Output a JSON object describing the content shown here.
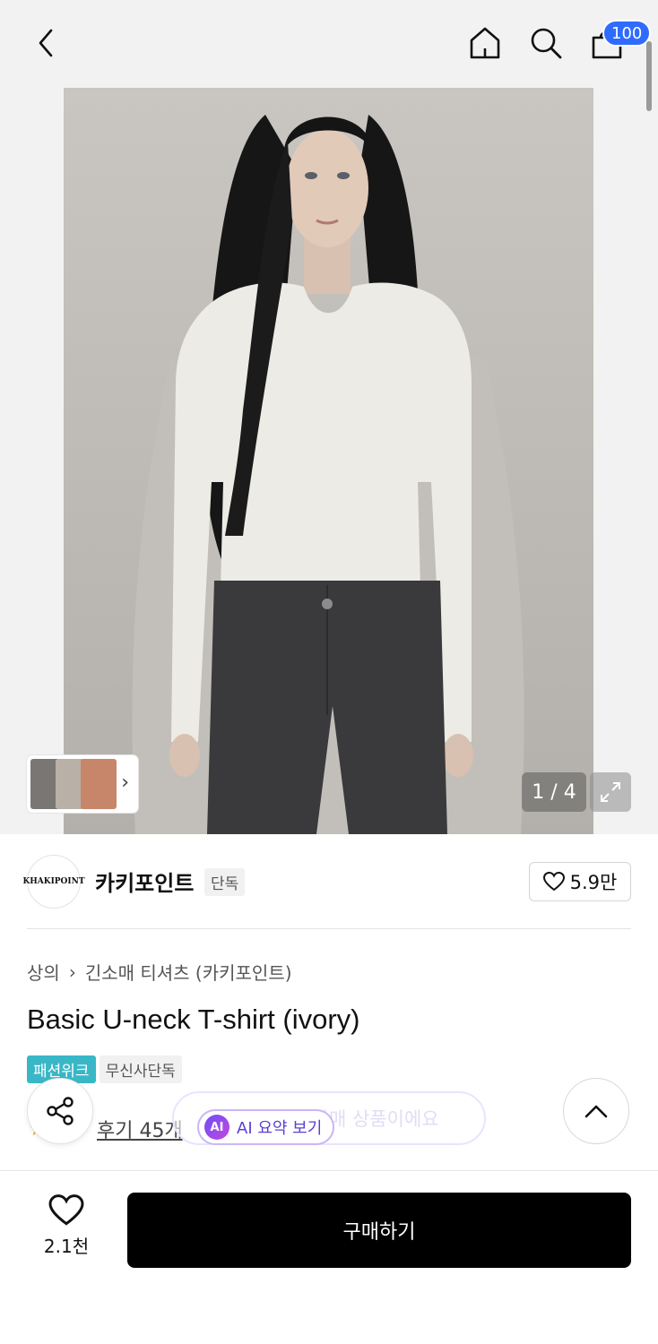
{
  "topbar": {
    "cart_count": "100"
  },
  "gallery": {
    "counter": "1 / 4"
  },
  "brand": {
    "name": "카키포인트",
    "tag": "단독",
    "logo_text": "KHAKIPOINT",
    "likes": "5.9만"
  },
  "breadcrumb": {
    "category": "상의",
    "subcategory": "긴소매 티셔츠 (카키포인트)"
  },
  "product": {
    "title": "Basic U-neck T-shirt (ivory)",
    "badges": [
      "패션위크",
      "무신사단독"
    ]
  },
  "reviews": {
    "link": "후기 45개"
  },
  "banner": {
    "ghost_text": "무신사단독 판매 상품이에요",
    "ai_mark": "AI",
    "ai_label": "AI 요약 보기"
  },
  "bottom": {
    "wish_count": "2.1천",
    "buy_label": "구매하기"
  },
  "colors": {
    "accent_blue": "#2f6bff",
    "teal": "#39b7c6",
    "ai_purple": "#5b3fd1"
  }
}
